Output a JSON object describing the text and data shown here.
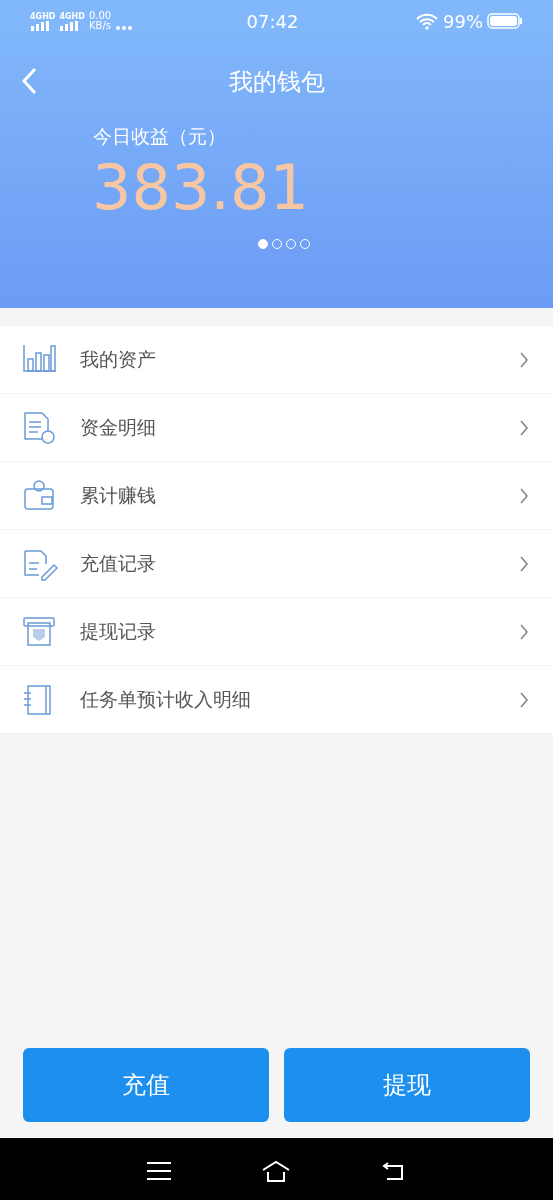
{
  "status_bar": {
    "network": [
      "4GHD",
      "4GHD"
    ],
    "speed": "0.00",
    "speed_unit": "KB/s",
    "time": "07:42",
    "battery": "99%"
  },
  "header": {
    "title": "我的钱包",
    "label": "今日收益（元）",
    "amount": "383.81",
    "pager": [
      {
        "selected": true
      },
      {
        "selected": false
      },
      {
        "selected": false
      },
      {
        "selected": false
      }
    ]
  },
  "menu": [
    {
      "kind": "chart",
      "label": "我的资产"
    },
    {
      "kind": "document",
      "label": "资金明细"
    },
    {
      "kind": "wallet",
      "label": "累计赚钱"
    },
    {
      "kind": "pen",
      "label": "充值记录"
    },
    {
      "kind": "atm",
      "label": "提现记录"
    },
    {
      "kind": "book",
      "label": "任务单预计收入明细"
    }
  ],
  "buttons": [
    "充值",
    "提现"
  ]
}
